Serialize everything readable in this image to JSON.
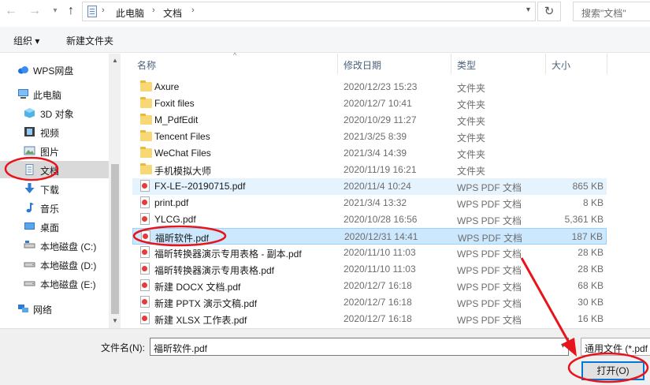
{
  "address": {
    "crumbs": [
      "此电脑",
      "文档"
    ],
    "search_placeholder": "搜索\"文档\""
  },
  "toolbar": {
    "organize": "组织 ▾",
    "new_folder": "新建文件夹"
  },
  "nav": {
    "items": [
      {
        "label": "WPS网盘",
        "icon": "cloud-icon"
      },
      {
        "label": "此电脑",
        "icon": "computer-icon"
      },
      {
        "label": "3D 对象",
        "icon": "cube-icon"
      },
      {
        "label": "视频",
        "icon": "film-icon"
      },
      {
        "label": "图片",
        "icon": "picture-icon"
      },
      {
        "label": "文档",
        "icon": "document-icon"
      },
      {
        "label": "下载",
        "icon": "download-arrow-icon"
      },
      {
        "label": "音乐",
        "icon": "music-note-icon"
      },
      {
        "label": "桌面",
        "icon": "desktop-icon"
      },
      {
        "label": "本地磁盘 (C:)",
        "icon": "drive-icon"
      },
      {
        "label": "本地磁盘 (D:)",
        "icon": "drive-icon"
      },
      {
        "label": "本地磁盘 (E:)",
        "icon": "drive-icon"
      },
      {
        "label": "网络",
        "icon": "network-icon"
      }
    ]
  },
  "columns": {
    "name": "名称",
    "date": "修改日期",
    "type": "类型",
    "size": "大小"
  },
  "files": [
    {
      "name": "Axure",
      "date": "2020/12/23 15:23",
      "type": "文件夹",
      "size": "",
      "kind": "folder"
    },
    {
      "name": "Foxit files",
      "date": "2020/12/7 10:41",
      "type": "文件夹",
      "size": "",
      "kind": "folder"
    },
    {
      "name": "M_PdfEdit",
      "date": "2020/10/29 11:27",
      "type": "文件夹",
      "size": "",
      "kind": "folder"
    },
    {
      "name": "Tencent Files",
      "date": "2021/3/25 8:39",
      "type": "文件夹",
      "size": "",
      "kind": "folder"
    },
    {
      "name": "WeChat Files",
      "date": "2021/3/4 14:39",
      "type": "文件夹",
      "size": "",
      "kind": "folder"
    },
    {
      "name": "手机模拟大师",
      "date": "2020/11/19 16:21",
      "type": "文件夹",
      "size": "",
      "kind": "folder"
    },
    {
      "name": "FX-LE--20190715.pdf",
      "date": "2020/11/4 10:24",
      "type": "WPS PDF 文档",
      "size": "865 KB",
      "kind": "pdf"
    },
    {
      "name": "print.pdf",
      "date": "2021/3/4 13:32",
      "type": "WPS PDF 文档",
      "size": "8 KB",
      "kind": "pdf"
    },
    {
      "name": "YLCG.pdf",
      "date": "2020/10/28 16:56",
      "type": "WPS PDF 文档",
      "size": "5,361 KB",
      "kind": "pdf"
    },
    {
      "name": "福昕软件.pdf",
      "date": "2020/12/31 14:41",
      "type": "WPS PDF 文档",
      "size": "187 KB",
      "kind": "pdf"
    },
    {
      "name": "福昕转换器演示专用表格 - 副本.pdf",
      "date": "2020/11/10 11:03",
      "type": "WPS PDF 文档",
      "size": "28 KB",
      "kind": "pdf"
    },
    {
      "name": "福昕转换器演示专用表格.pdf",
      "date": "2020/11/10 11:03",
      "type": "WPS PDF 文档",
      "size": "28 KB",
      "kind": "pdf"
    },
    {
      "name": "新建 DOCX 文档.pdf",
      "date": "2020/12/7 16:18",
      "type": "WPS PDF 文档",
      "size": "68 KB",
      "kind": "pdf"
    },
    {
      "name": "新建 PPTX 演示文稿.pdf",
      "date": "2020/12/7 16:18",
      "type": "WPS PDF 文档",
      "size": "30 KB",
      "kind": "pdf"
    },
    {
      "name": "新建 XLSX 工作表.pdf",
      "date": "2020/12/7 16:18",
      "type": "WPS PDF 文档",
      "size": "16 KB",
      "kind": "pdf"
    }
  ],
  "footer": {
    "filename_label": "文件名(N):",
    "filename_value": "福昕软件.pdf",
    "filetype_value": "通用文件 (*.pdf",
    "open_label": "打开(O)"
  },
  "colors": {
    "selection": "#cce8ff",
    "annotation": "#e8141b",
    "accent": "#0078d7"
  }
}
